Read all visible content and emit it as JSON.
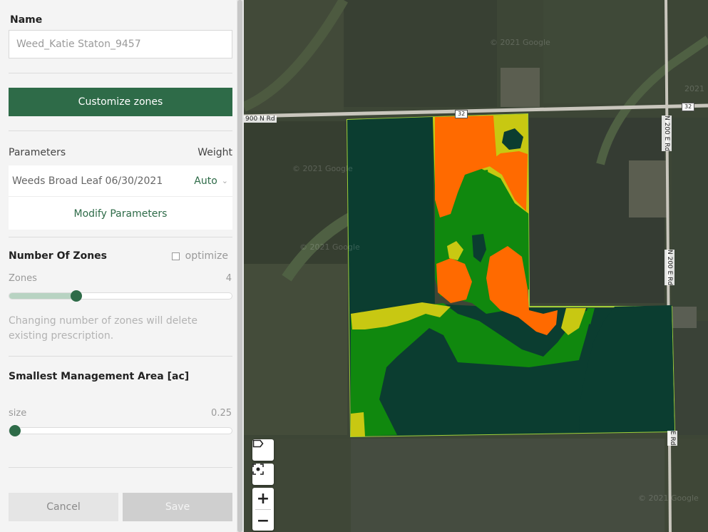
{
  "form": {
    "name_label": "Name",
    "name_value": "Weed_Katie Staton_9457",
    "customize_label": "Customize zones",
    "params_label": "Parameters",
    "weight_label": "Weight",
    "parameter_name": "Weeds Broad Leaf 06/30/2021",
    "parameter_weight": "Auto",
    "modify_label": "Modify Parameters",
    "zones_title": "Number Of Zones",
    "optimize_label": "optimize",
    "optimize_checked": false,
    "zones_label": "Zones",
    "zones_value": "4",
    "zones_slider_fraction": 0.29,
    "warning_text": "Changing number of zones will delete existing prescription.",
    "sma_title": "Smallest Management Area [ac]",
    "size_label": "size",
    "size_value": "0.25",
    "size_slider_fraction": 0.0,
    "cancel_label": "Cancel",
    "save_label": "Save"
  },
  "map": {
    "road_labels": {
      "road_900n": "900 N Rd",
      "road_200e_top": "N 200 E Rd",
      "road_200e_mid": "N 200 E Rd",
      "road_e_bottom": "E Rd",
      "shield_1": "32",
      "shield_2": "32"
    },
    "watermarks": [
      "© 2021 Google",
      "© 2021 Google",
      "© 2021 Google",
      "2021",
      "© 2021 Google"
    ],
    "zone_colors": {
      "zone_dark": "#0b3d30",
      "zone_green": "#10880e",
      "zone_yellow": "#c8c812",
      "zone_orange": "#ff6a00"
    },
    "controls": [
      "label-tag-icon",
      "locate-icon",
      "zoom-in",
      "zoom-out"
    ],
    "zoom_in_label": "+",
    "zoom_out_label": "−"
  }
}
